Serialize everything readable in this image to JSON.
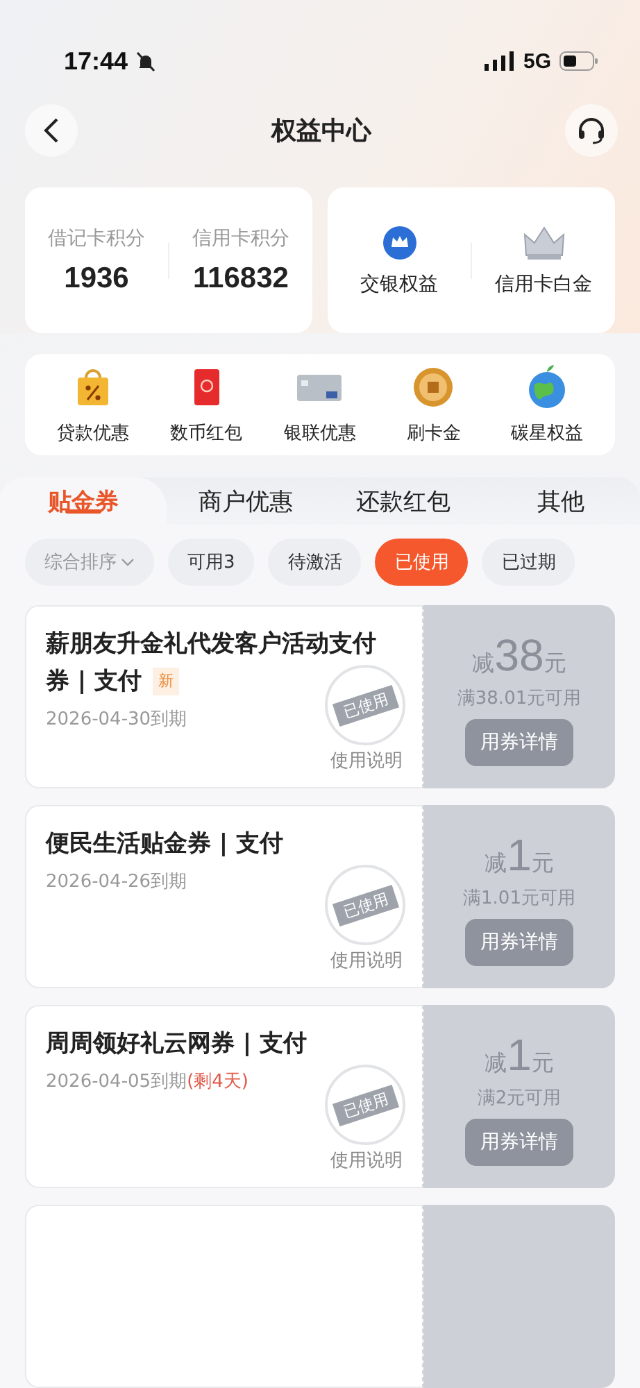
{
  "status_bar": {
    "time": "17:44",
    "network": "5G"
  },
  "nav": {
    "title": "权益中心"
  },
  "points": [
    {
      "label": "借记卡积分",
      "value": "1936"
    },
    {
      "label": "信用卡积分",
      "value": "116832"
    }
  ],
  "perks": [
    {
      "label": "交银权益"
    },
    {
      "label": "信用卡白金"
    }
  ],
  "services": [
    {
      "label": "贷款优惠"
    },
    {
      "label": "数币红包"
    },
    {
      "label": "银联优惠"
    },
    {
      "label": "刷卡金"
    },
    {
      "label": "碳星权益"
    }
  ],
  "tabs": [
    {
      "label": "贴金券",
      "selected": true
    },
    {
      "label": "商户优惠",
      "selected": false
    },
    {
      "label": "还款红包",
      "selected": false
    },
    {
      "label": "其他",
      "selected": false
    }
  ],
  "filters": [
    {
      "label": "综合排序",
      "kind": "sort",
      "selected": false
    },
    {
      "label": "可用3",
      "kind": "chip",
      "selected": false
    },
    {
      "label": "待激活",
      "kind": "chip",
      "selected": false
    },
    {
      "label": "已使用",
      "kind": "chip",
      "selected": true
    },
    {
      "label": "已过期",
      "kind": "chip",
      "selected": false
    }
  ],
  "coupons": [
    {
      "title": "薪朋友升金礼代发客户活动支付券 | 支付",
      "tag": "新",
      "expiry": "2026-04-30到期",
      "stamp": "已使用",
      "note": "使用说明",
      "prefix": "减",
      "amount": "38",
      "unit": "元",
      "condition": "满38.01元可用",
      "button": "用券详情"
    },
    {
      "title": "便民生活贴金券 | 支付",
      "expiry": "2026-04-26到期",
      "stamp": "已使用",
      "note": "使用说明",
      "prefix": "减",
      "amount": "1",
      "unit": "元",
      "condition": "满1.01元可用",
      "button": "用券详情"
    },
    {
      "title": "周周领好礼云网券 | 支付",
      "expiry": "2026-04-05到期",
      "remaining": "(剩4天)",
      "stamp": "已使用",
      "note": "使用说明",
      "prefix": "减",
      "amount": "1",
      "unit": "元",
      "condition": "满2元可用",
      "button": "用券详情"
    }
  ]
}
